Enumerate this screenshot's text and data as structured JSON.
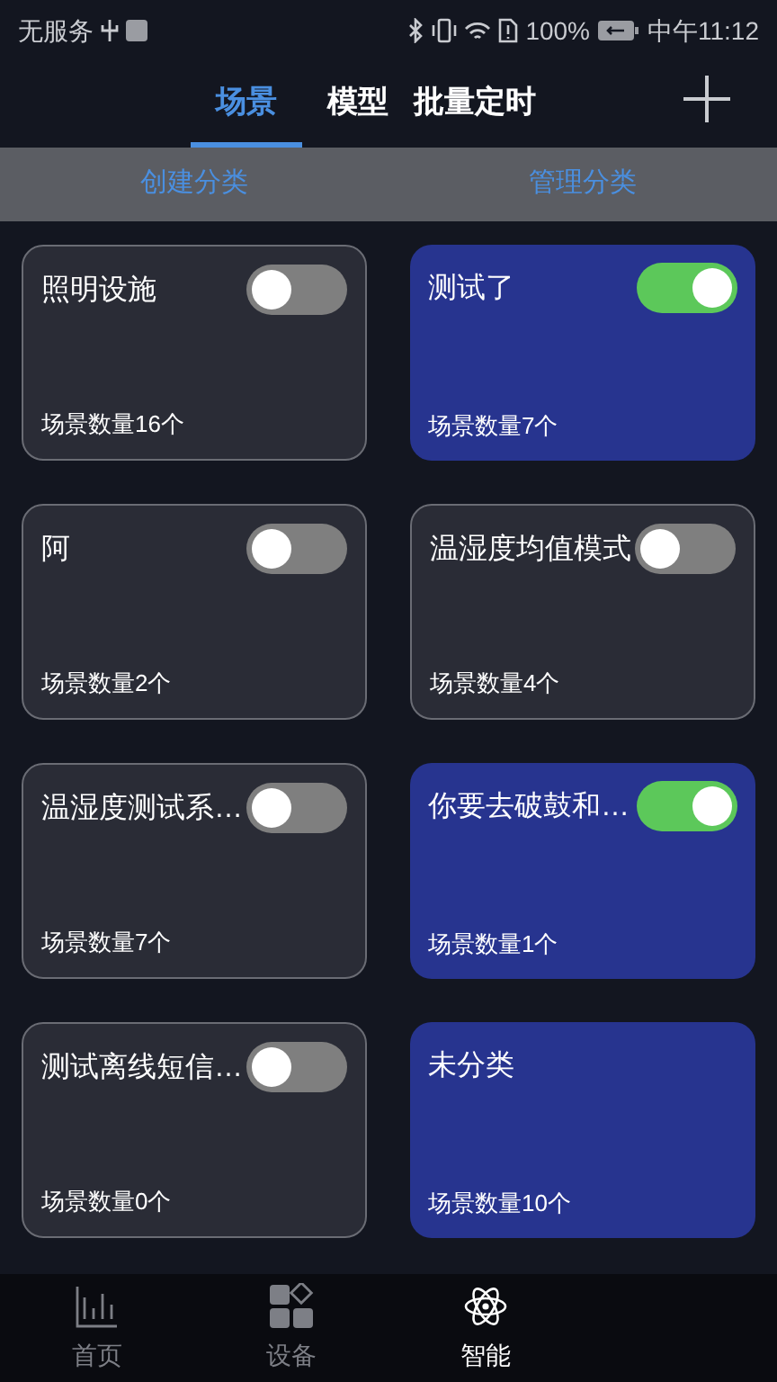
{
  "status_bar": {
    "carrier": "无服务",
    "battery": "100%",
    "time": "中午11:12"
  },
  "tabs": [
    {
      "label": "场景",
      "selected": true
    },
    {
      "label": "模型",
      "selected": false
    },
    {
      "label": "批量定时",
      "selected": false
    }
  ],
  "sub_actions": [
    "创建分类",
    "管理分类"
  ],
  "categories": [
    {
      "name": "照明设施",
      "count": "场景数量16个",
      "kind": "switch",
      "on": false
    },
    {
      "name": "测试了",
      "count": "场景数量7个",
      "kind": "switch",
      "on": true
    },
    {
      "name": "阿",
      "count": "场景数量2个",
      "kind": "switch",
      "on": false
    },
    {
      "name": "温湿度均值模式",
      "count": "场景数量4个",
      "kind": "switch",
      "on": false
    },
    {
      "name": "温湿度测试系…",
      "count": "场景数量7个",
      "kind": "switch",
      "on": false
    },
    {
      "name": "你要去破鼓和…",
      "count": "场景数量1个",
      "kind": "switch",
      "on": true
    },
    {
      "name": "测试离线短信…",
      "count": "场景数量0个",
      "kind": "switch",
      "on": false
    },
    {
      "name": "未分类",
      "count": "场景数量10个",
      "kind": "plain"
    }
  ],
  "bottom_nav": [
    {
      "label": "首页",
      "kind": "chart",
      "selected": false
    },
    {
      "label": "设备",
      "kind": "blocks",
      "selected": false
    },
    {
      "label": "智能",
      "kind": "atom",
      "selected": true
    }
  ]
}
